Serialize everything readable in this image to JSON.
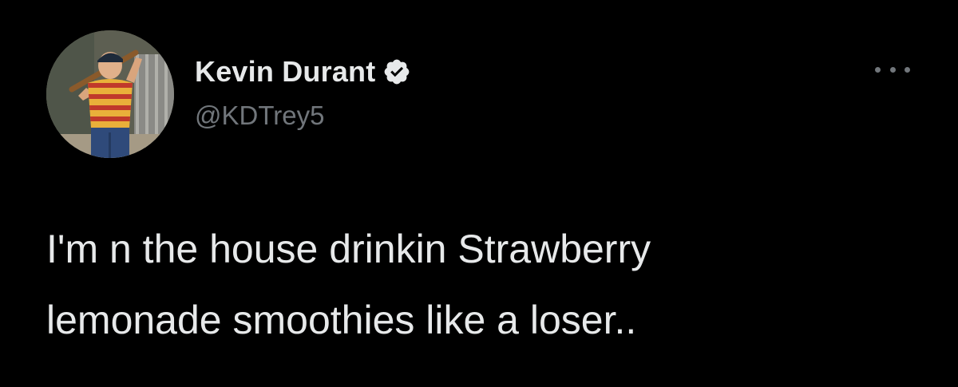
{
  "tweet": {
    "author": {
      "display_name": "Kevin Durant",
      "handle": "@KDTrey5",
      "verified": true,
      "avatar_icon": "avatar-boy-with-bat"
    },
    "more_icon": "more-options-icon",
    "text_lines": [
      "I'm n the house drinkin Strawberry",
      "lemonade smoothies like a loser.."
    ]
  },
  "colors": {
    "background": "#000000",
    "text": "#e7e9ea",
    "secondary_text": "#71767b",
    "verified_badge": "#e7e9ea"
  }
}
